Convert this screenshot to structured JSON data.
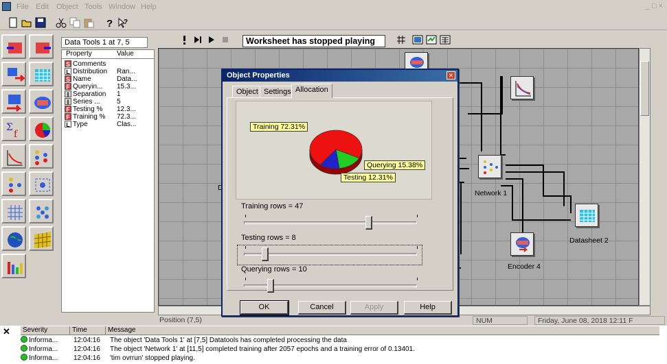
{
  "menu": {
    "items": [
      {
        "label": "File",
        "u": "F"
      },
      {
        "label": "Edit",
        "u": "E"
      },
      {
        "label": "Object",
        "u": "O"
      },
      {
        "label": "Tools",
        "u": "T"
      },
      {
        "label": "Window",
        "u": "W"
      },
      {
        "label": "Help",
        "u": "H"
      }
    ],
    "window_controls": "_ □ ×"
  },
  "toolbar": {
    "icons": [
      "new-icon",
      "open-icon",
      "save-icon",
      "cut-icon",
      "copy-icon",
      "paste-icon",
      "help-icon",
      "context-help-icon"
    ]
  },
  "palette": {
    "icons": [
      "import-icon",
      "export-icon",
      "transform-icon",
      "datasheet-icon",
      "network-icon",
      "encoder-icon",
      "formula-icon",
      "pie-chart-icon",
      "line-chart-icon",
      "classifier-icon",
      "cluster-icon",
      "som-icon",
      "kohonen-icon",
      "map-icon",
      "globe-icon",
      "grid-icon",
      "bar-chart-icon"
    ]
  },
  "properties": {
    "title": "Data Tools 1 at 7, 5",
    "col_property": "Property",
    "col_value": "Value",
    "rows": [
      {
        "type": "S",
        "name": "Comments",
        "value": ""
      },
      {
        "type": "L",
        "name": "Distribution",
        "value": "Ran..."
      },
      {
        "type": "S",
        "name": "Name",
        "value": "Data..."
      },
      {
        "type": "F",
        "name": "Queryin...",
        "value": "15.3..."
      },
      {
        "type": "I",
        "name": "Separation",
        "value": "1"
      },
      {
        "type": "I",
        "name": "Series ...",
        "value": "5"
      },
      {
        "type": "F",
        "name": "Testing %",
        "value": "12.3..."
      },
      {
        "type": "F",
        "name": "Training %",
        "value": "72.3..."
      },
      {
        "type": "L",
        "name": "Type",
        "value": "Clas..."
      }
    ]
  },
  "runbar": {
    "status": "Worksheet has stopped playing",
    "buttons": [
      "stop-icon",
      "step-icon",
      "play-icon",
      "pause-icon"
    ],
    "view_buttons": [
      "grid-toggle-icon",
      "view1-icon",
      "view2-icon",
      "view3-icon"
    ]
  },
  "canvas": {
    "nodes": [
      {
        "name": "encoder-node-top",
        "label": ""
      },
      {
        "name": "chart-node",
        "label": ""
      },
      {
        "name": "network-node",
        "label": "Network 1"
      },
      {
        "name": "datasheet-node",
        "label": "Datasheet 2"
      },
      {
        "name": "encoder-node",
        "label": "Encoder 4"
      }
    ],
    "partial_label": "D"
  },
  "dialog": {
    "title": "Object Properties",
    "tabs": [
      "Object",
      "Settings",
      "Allocation"
    ],
    "active_tab": "Allocation",
    "buttons": {
      "ok": "OK",
      "cancel": "Cancel",
      "apply": "Apply",
      "help": "Help"
    },
    "sliders": [
      {
        "label": "Training rows = 47",
        "value": 47
      },
      {
        "label": "Testing rows = 8",
        "value": 8
      },
      {
        "label": "Querying rows = 10",
        "value": 10
      }
    ],
    "slider_max": 65
  },
  "chart_data": {
    "type": "pie",
    "slices": [
      {
        "label": "Training 72.31%",
        "value": 72.31,
        "color": "#ee1111"
      },
      {
        "label": "Querying 15.38%",
        "value": 15.38,
        "color": "#22cc22"
      },
      {
        "label": "Testing 12.31%",
        "value": 12.31,
        "color": "#2222cc"
      }
    ]
  },
  "statusbar": {
    "position": "Position (7,5)",
    "num": "NUM",
    "datetime": "Friday, June 08, 2018  12:11 F"
  },
  "log": {
    "headers": {
      "severity": "Severity",
      "time": "Time",
      "message": "Message"
    },
    "rows": [
      {
        "severity": "Informa...",
        "time": "12:04:16",
        "message": "The object 'Data Tools 1' at [7,5] Datatools has completed processing the data"
      },
      {
        "severity": "Informa...",
        "time": "12:04:16",
        "message": "The object 'Network 1' at [11,5] completed training after 2057 epochs and a training error of 0.13401."
      },
      {
        "severity": "Informa...",
        "time": "12:04:16",
        "message": "'tim ovrrun' stopped playing."
      }
    ]
  }
}
